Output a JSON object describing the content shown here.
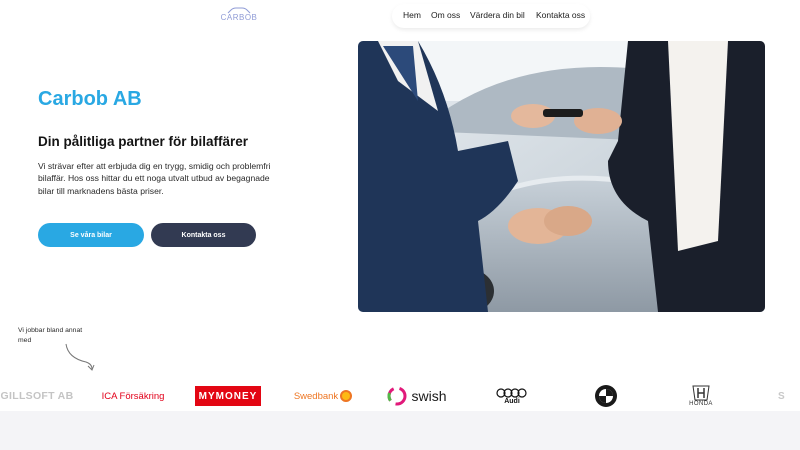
{
  "header": {
    "logo_text": "CARBOB",
    "nav": [
      "Hem",
      "Om oss",
      "Värdera din bil",
      "Kontakta oss"
    ]
  },
  "hero": {
    "title": "Carbob AB",
    "subtitle": "Din pålitliga partner för bilaffärer",
    "description": "Vi strävar efter att erbjuda dig en trygg, smidig och problemfri bilaffär. Hos oss hittar du ett noga utvalt utbud av begagnade bilar till marknadens bästa priser.",
    "primary_button": "Se våra bilar",
    "secondary_button": "Kontakta oss"
  },
  "partners": {
    "note": "Vi jobbar bland annat med",
    "logos": [
      "GILLSOFT AB",
      "ICA Försäkring",
      "MYMONEY",
      "Swedbank",
      "swish",
      "Audi",
      "BMW",
      "HONDA",
      "S"
    ]
  },
  "colors": {
    "accent": "#29a8e3",
    "dark_button": "#323a52"
  }
}
